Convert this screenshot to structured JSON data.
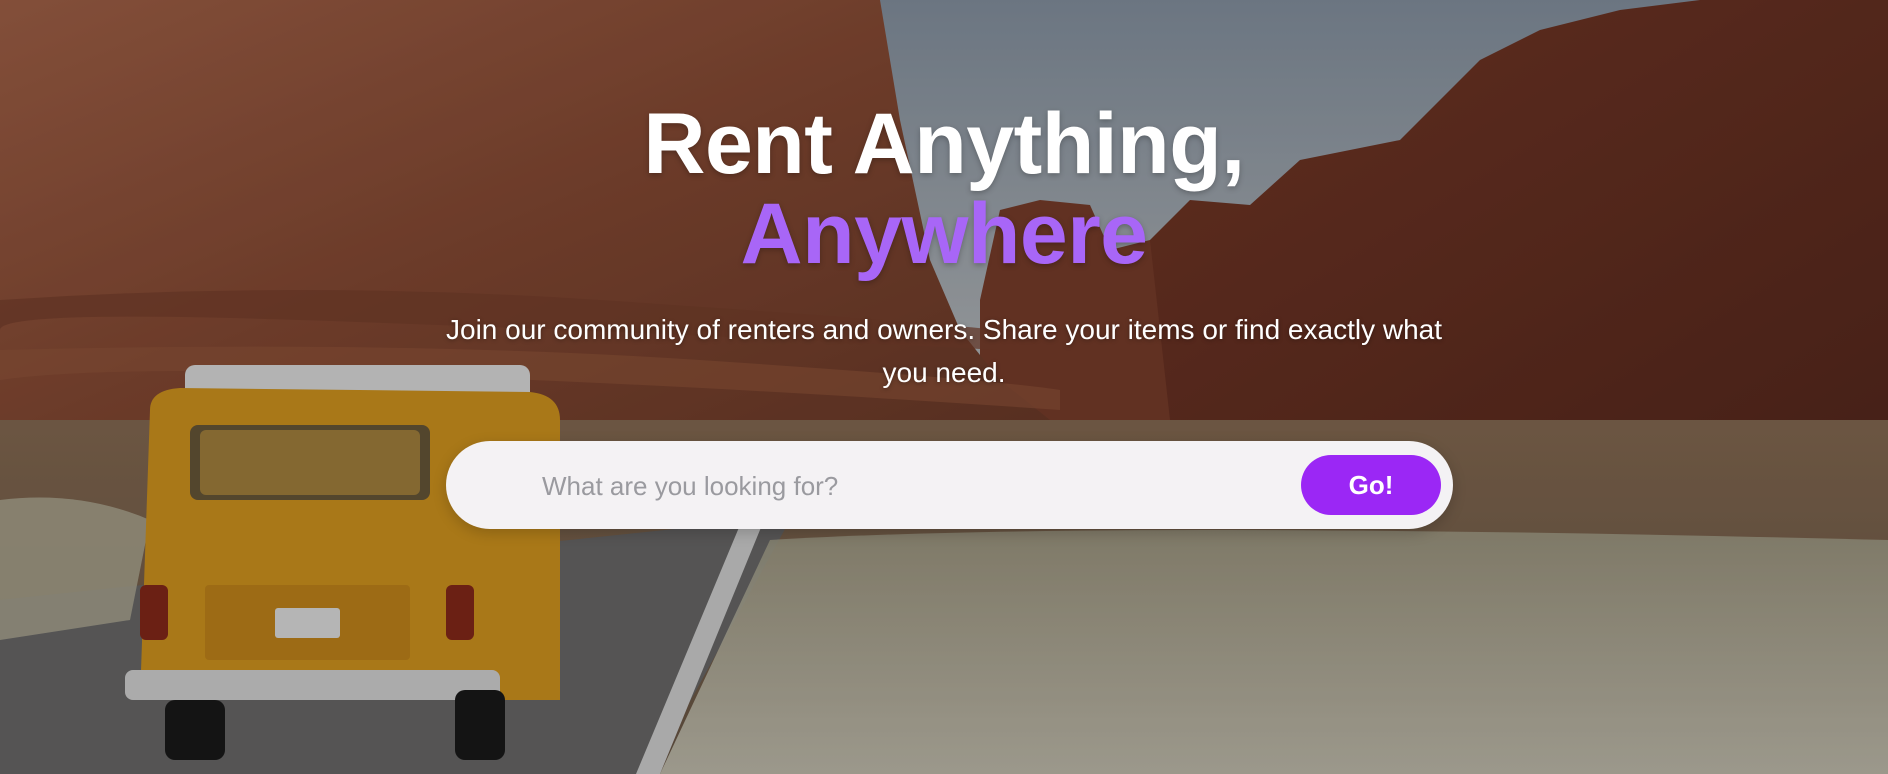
{
  "hero": {
    "title_line_1": "Rent Anything,",
    "title_line_2": "Anywhere",
    "subtitle": "Join our community of renters and owners. Share your items or find exactly what you need.",
    "background_image": "desert-road-van-photo"
  },
  "search": {
    "placeholder": "What are you looking for?",
    "value": "",
    "button_label": "Go!"
  },
  "colors": {
    "accent": "#9b27f5",
    "accent_text": "#a866f7",
    "title": "#ffffff",
    "search_bg": "#f4f2f4"
  }
}
